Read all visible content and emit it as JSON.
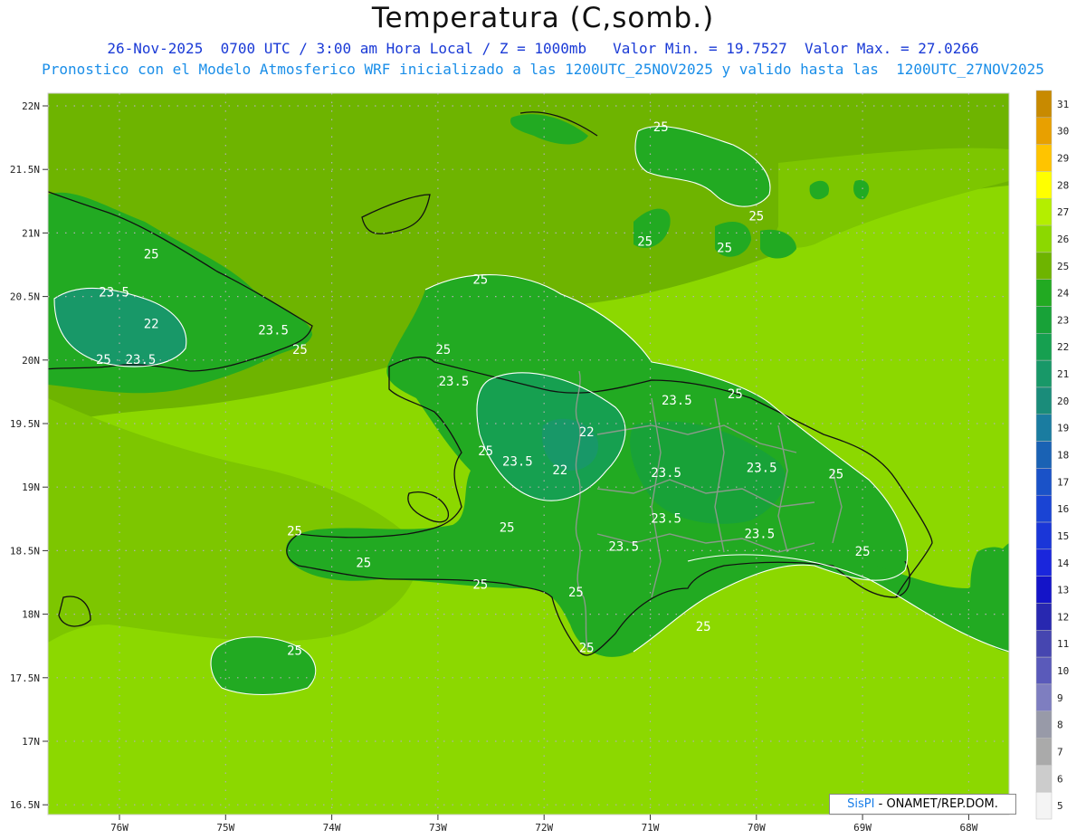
{
  "header": {
    "title": "Temperatura (C,somb.)",
    "line1": "26-Nov-2025  0700 UTC / 3:00 am Hora Local / Z = 1000mb   Valor Min. = 19.7527  Valor Max. = 27.0266",
    "line2": "Pronostico con el Modelo Atmosferico WRF inicializado a las 1200UTC_25NOV2025 y valido hasta las  1200UTC_27NOV2025"
  },
  "axes": {
    "lat_labels": [
      "22N",
      "21.5N",
      "21N",
      "20.5N",
      "20N",
      "19.5N",
      "19N",
      "18.5N",
      "18N",
      "17.5N",
      "17N",
      "16.5N"
    ],
    "lon_labels": [
      "76W",
      "75W",
      "74W",
      "73W",
      "72W",
      "71W",
      "70W",
      "69W",
      "68W"
    ]
  },
  "colorbar": {
    "levels": [
      "31",
      "30",
      "29",
      "28",
      "27",
      "26",
      "25",
      "24",
      "23",
      "22",
      "21",
      "20",
      "19",
      "18",
      "17",
      "16",
      "15",
      "14",
      "13",
      "12",
      "11",
      "10",
      "9",
      "8",
      "7",
      "6",
      "5"
    ],
    "colors": [
      "#c88a00",
      "#e8a000",
      "#ffc400",
      "#ffff00",
      "#b4ee00",
      "#8cd800",
      "#6eb400",
      "#22aa22",
      "#18a238",
      "#16a050",
      "#189868",
      "#1a8c7a",
      "#1a7ca0",
      "#1a62b4",
      "#1a52c8",
      "#1a44d4",
      "#1a36d8",
      "#1a26dc",
      "#1414c8",
      "#2828b0",
      "#4646b0",
      "#5a5aba",
      "#7e7ec0",
      "#989aa8",
      "#aaaaaa",
      "#cccccc",
      "#f4f4f4"
    ]
  },
  "contour_labels": [
    {
      "text": "25",
      "lon": -70.9,
      "lat": 21.8
    },
    {
      "text": "25",
      "lon": -70.0,
      "lat": 21.1
    },
    {
      "text": "25",
      "lon": -71.05,
      "lat": 20.9
    },
    {
      "text": "25",
      "lon": -70.3,
      "lat": 20.85
    },
    {
      "text": "25",
      "lon": -75.7,
      "lat": 20.8
    },
    {
      "text": "23.5",
      "lon": -76.05,
      "lat": 20.5
    },
    {
      "text": "22",
      "lon": -75.7,
      "lat": 20.25
    },
    {
      "text": "23.5",
      "lon": -74.55,
      "lat": 20.2
    },
    {
      "text": "25",
      "lon": -74.3,
      "lat": 20.05
    },
    {
      "text": "25",
      "lon": -76.15,
      "lat": 19.97
    },
    {
      "text": "23.5",
      "lon": -75.8,
      "lat": 19.97
    },
    {
      "text": "25",
      "lon": -72.6,
      "lat": 20.6
    },
    {
      "text": "25",
      "lon": -72.95,
      "lat": 20.05
    },
    {
      "text": "23.5",
      "lon": -72.85,
      "lat": 19.8
    },
    {
      "text": "25",
      "lon": -70.2,
      "lat": 19.7
    },
    {
      "text": "23.5",
      "lon": -70.75,
      "lat": 19.65
    },
    {
      "text": "22",
      "lon": -71.6,
      "lat": 19.4
    },
    {
      "text": "25",
      "lon": -72.55,
      "lat": 19.25
    },
    {
      "text": "23.5",
      "lon": -72.25,
      "lat": 19.17
    },
    {
      "text": "22",
      "lon": -71.85,
      "lat": 19.1
    },
    {
      "text": "23.5",
      "lon": -70.85,
      "lat": 19.08
    },
    {
      "text": "23.5",
      "lon": -69.95,
      "lat": 19.12
    },
    {
      "text": "25",
      "lon": -69.25,
      "lat": 19.07
    },
    {
      "text": "23.5",
      "lon": -70.85,
      "lat": 18.72
    },
    {
      "text": "25",
      "lon": -72.35,
      "lat": 18.65
    },
    {
      "text": "25",
      "lon": -74.35,
      "lat": 18.62
    },
    {
      "text": "23.5",
      "lon": -69.97,
      "lat": 18.6
    },
    {
      "text": "23.5",
      "lon": -71.25,
      "lat": 18.5
    },
    {
      "text": "25",
      "lon": -69.0,
      "lat": 18.46
    },
    {
      "text": "25",
      "lon": -73.7,
      "lat": 18.37
    },
    {
      "text": "25",
      "lon": -72.6,
      "lat": 18.2
    },
    {
      "text": "25",
      "lon": -71.7,
      "lat": 18.14
    },
    {
      "text": "25",
      "lon": -70.5,
      "lat": 17.87
    },
    {
      "text": "25",
      "lon": -74.35,
      "lat": 17.68
    },
    {
      "text": "25",
      "lon": -71.6,
      "lat": 17.7
    }
  ],
  "footer": {
    "brand": "SisPI",
    "credit": " - ONAMET/REP.DOM."
  }
}
